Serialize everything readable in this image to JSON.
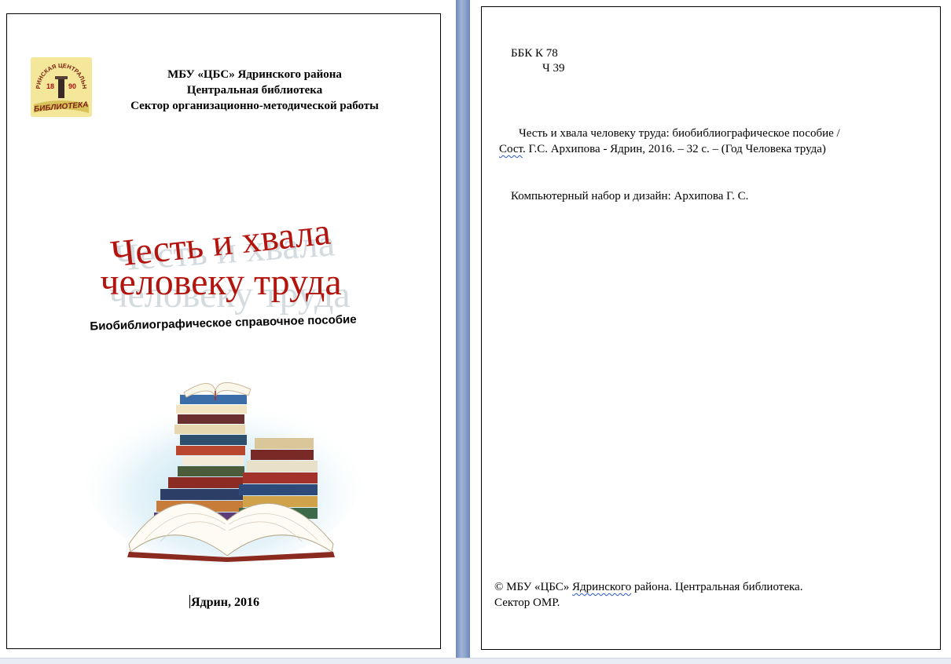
{
  "left_page": {
    "logo": {
      "arc_text": "ЯДРИНСКАЯ ЦЕНТРАЛЬНАЯ",
      "year_left": "18",
      "year_right": "90",
      "banner_text": "БИБЛИОТЕКА",
      "icon": "library-emblem-icon"
    },
    "header": {
      "line1": "МБУ «ЦБС» Ядринского района",
      "line2": "Центральная библиотека",
      "line3": "Сектор организационно-методической работы"
    },
    "title": {
      "line1": "Честь и хвала",
      "line2": "человеку труда",
      "color": "#b3140e",
      "shadow_color": "#c9d2d6"
    },
    "subtitle": "Биобиблиографическое справочное пособие",
    "illustration": "stack-of-books-icon",
    "footer": "Ядрин, 2016"
  },
  "right_page": {
    "bbk": {
      "line1": "ББК К 78",
      "line2": "Ч 39"
    },
    "citation": {
      "line1": "Честь и хвала человеку труда: биобиблиографическое пособие /",
      "line2_prefix": "Сост",
      "line2_rest": ". Г.С. Архипова - Ядрин, 2016. –  32 с. – (Год Человека труда)"
    },
    "credits": "Компьютерный набор и дизайн: Архипова Г. С.",
    "copyright": {
      "line1_prefix": "© МБУ «ЦБС» ",
      "line1_marked": "Ядринского",
      "line1_rest": " района. Центральная библиотека.",
      "line2": "Сектор ОМР."
    }
  },
  "colors": {
    "divider": "#8aa1cc",
    "spellcheck": "#2b57c9"
  }
}
